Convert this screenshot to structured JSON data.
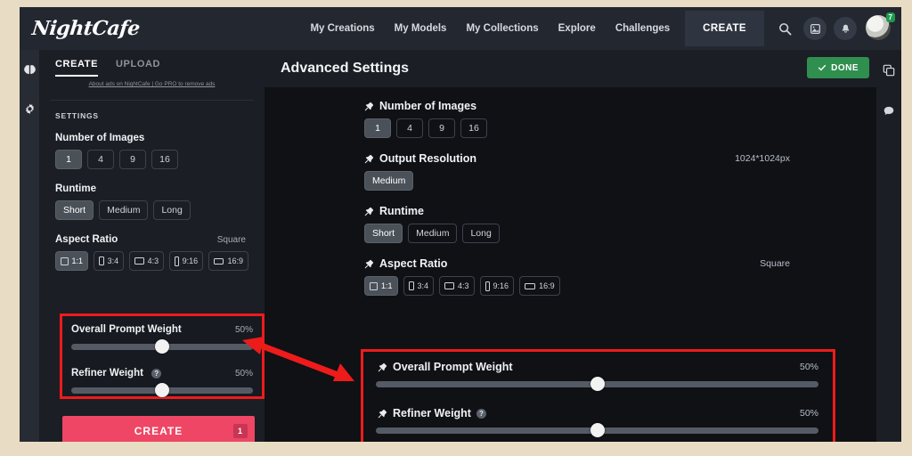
{
  "brand": {
    "logo": "NightCafe"
  },
  "topnav": {
    "links": [
      "My Creations",
      "My Models",
      "My Collections",
      "Explore",
      "Challenges"
    ],
    "create_label": "CREATE",
    "icons": [
      "search-icon",
      "image-stack-icon",
      "bell-icon"
    ],
    "avatar_badge": "7"
  },
  "rail": {
    "icons": [
      "brain-icon",
      "gear-icon"
    ]
  },
  "sidebar": {
    "tabs": [
      {
        "label": "CREATE",
        "active": true
      },
      {
        "label": "UPLOAD",
        "active": false
      }
    ],
    "ads_note": "About ads on NightCafe | Go PRO to remove ads",
    "settings_label": "SETTINGS",
    "number_of_images": {
      "title": "Number of Images",
      "options": [
        "1",
        "4",
        "9",
        "16"
      ],
      "selected": "1"
    },
    "runtime": {
      "title": "Runtime",
      "options": [
        "Short",
        "Medium",
        "Long"
      ],
      "selected": "Short"
    },
    "aspect_ratio": {
      "title": "Aspect Ratio",
      "value": "Square",
      "options": [
        "1:1",
        "3:4",
        "4:3",
        "9:16",
        "16:9"
      ],
      "selected": "1:1"
    },
    "overall_prompt_weight": {
      "title": "Overall Prompt Weight",
      "value": "50%",
      "percent": 50
    },
    "refiner_weight": {
      "title": "Refiner Weight",
      "value": "50%",
      "percent": 50,
      "help": "?"
    },
    "create_button": {
      "label": "CREATE",
      "badge": "1"
    }
  },
  "main": {
    "title": "Advanced Settings",
    "done_button": {
      "label": "DONE",
      "icon": "check-icon"
    },
    "right_icons": [
      "duplicate-icon",
      "chat-bubble-icon"
    ],
    "number_of_images": {
      "title": "Number of Images",
      "options": [
        "1",
        "4",
        "9",
        "16"
      ],
      "selected": "1"
    },
    "output_resolution": {
      "title": "Output Resolution",
      "value": "1024*1024px",
      "options": [
        "Medium"
      ],
      "selected": "Medium"
    },
    "runtime": {
      "title": "Runtime",
      "options": [
        "Short",
        "Medium",
        "Long"
      ],
      "selected": "Short"
    },
    "aspect_ratio": {
      "title": "Aspect Ratio",
      "value": "Square",
      "options": [
        "1:1",
        "3:4",
        "4:3",
        "9:16",
        "16:9"
      ],
      "selected": "1:1"
    },
    "overall_prompt_weight": {
      "title": "Overall Prompt Weight",
      "value": "50%",
      "percent": 50
    },
    "refiner_weight": {
      "title": "Refiner Weight",
      "value": "50%",
      "percent": 50,
      "help": "?"
    }
  },
  "annotations": {
    "highlight_color": "#ee1b1b",
    "arrow": "double-headed-arrow"
  }
}
